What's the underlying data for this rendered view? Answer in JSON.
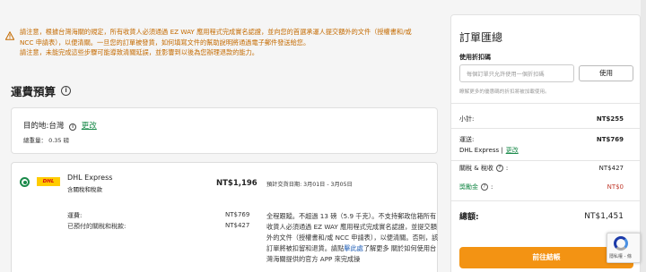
{
  "notice": {
    "line1": "請注意，根據台灣海關的規定，所有收貨人必須通過 EZ WAY 應用程式完成實名認證，並向您的首選承運人提交額外的文件（授權書和/或",
    "line2": "NCC 申請表），以便清關。一旦您的訂單被發貨，如何填寫文件的幫助說明將通過電子郵件發送給您。",
    "line3": "請注意，未能完成這些步驟可能導致清關延誤，並影響到以後為您辦理退款的能力。",
    "color": "#c46a00"
  },
  "shipping_section": {
    "title": "運費預算",
    "info_icon": "i"
  },
  "destination": {
    "label": "目的地:台灣",
    "change_link": "更改",
    "weight": "總重量：  0.35 磅"
  },
  "carrier": {
    "logo_text": "DHL",
    "name": "DHL Express",
    "subtitle": "含關稅和稅款",
    "price": "NT$1,196",
    "eta": "預計交貨日期: 3月01日 - 3月05日",
    "fees": [
      {
        "label": "運費:",
        "value": "NT$769"
      },
      {
        "label": "已預付的關稅和稅款:",
        "value": "NT$427"
      }
    ],
    "detail_part1": "全程跟蹤。不超過 13 磅（5.9 千克）。不支持郵政信箱所有收貨人必須通過 EZ WAY 應用程式完成實名認證，並提交額外的文件（授權書和/或 NCC 申請表），以便清關。否則，該訂單將被扣留和退貨。請點",
    "detail_link": "擊此處",
    "detail_part2": "了解更多 關於如何使用台灣海關提供的官方 APP 來完成操"
  },
  "summary": {
    "title": "訂單匯總",
    "coupon_label": "使用折扣碼",
    "coupon_placeholder": "每個訂單只允許使用一個折扣碼",
    "coupon_button": "使用",
    "coupon_hint": "瞭解更多的優惠碼的折扣將被加載使用。",
    "subtotal_label": "小計:",
    "subtotal_value": "NT$255",
    "shipping_label": "運送:",
    "shipping_value": "NT$769",
    "shipping_carrier": "DHL Express |",
    "shipping_change": "更改",
    "duties_label": "關稅 & 稅收",
    "duties_value": "NT$427",
    "reward_label": "獎勵金",
    "reward_value": "NT$0",
    "total_label": "總額:",
    "total_value": "NT$1,451",
    "checkout_button": "前往結帳",
    "accent": "#f39313"
  },
  "recaptcha": {
    "text": "隱私權 - 條"
  }
}
